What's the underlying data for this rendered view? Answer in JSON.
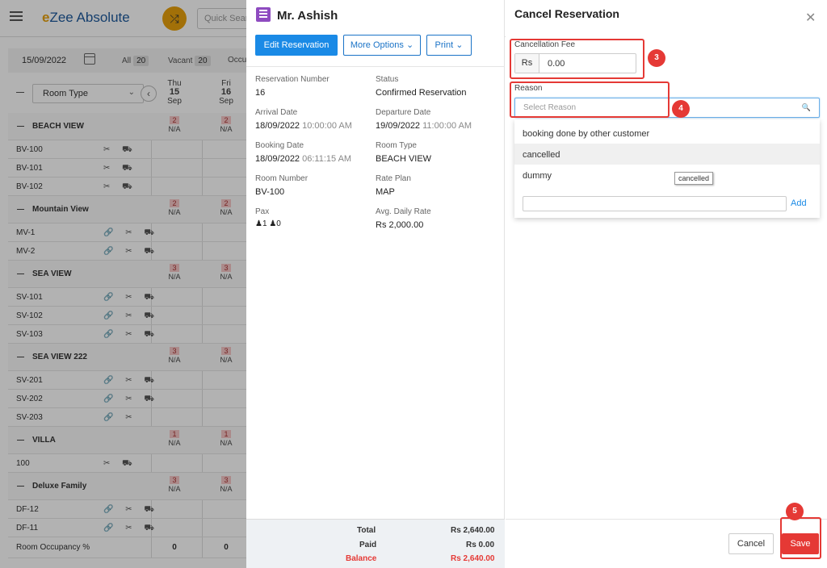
{
  "app": {
    "logo_prefix": "e",
    "logo_rest": "Zee Absolute",
    "search_placeholder": "Quick Sear"
  },
  "filters": {
    "date": "15/09/2022",
    "all_label": "All",
    "all_count": "20",
    "vacant_label": "Vacant",
    "vacant_count": "20",
    "occ_label": "Occu"
  },
  "grid": {
    "room_type_select": "Room Type",
    "days": [
      {
        "dow": "Thu",
        "day": "15",
        "mon": "Sep"
      },
      {
        "dow": "Fri",
        "day": "16",
        "mon": "Sep"
      }
    ],
    "groups": [
      {
        "name": "BEACH VIEW",
        "c1": "2",
        "c2": "2",
        "na": "N/A",
        "rooms": [
          "BV-100",
          "BV-101",
          "BV-102"
        ]
      },
      {
        "name": "Mountain View",
        "c1": "2",
        "c2": "2",
        "na": "N/A",
        "rooms": [
          "MV-1",
          "MV-2"
        ]
      },
      {
        "name": "SEA VIEW",
        "c1": "3",
        "c2": "3",
        "na": "N/A",
        "rooms": [
          "SV-101",
          "SV-102",
          "SV-103"
        ]
      },
      {
        "name": "SEA VIEW 222",
        "c1": "3",
        "c2": "3",
        "na": "N/A",
        "rooms": [
          "SV-201",
          "SV-202",
          "SV-203"
        ]
      },
      {
        "name": "VILLA",
        "c1": "1",
        "c2": "1",
        "na": "N/A",
        "rooms": [
          "100"
        ]
      },
      {
        "name": "Deluxe Family",
        "c1": "3",
        "c2": "3",
        "na": "N/A",
        "rooms": [
          "DF-12",
          "DF-11"
        ]
      }
    ],
    "occupancy_label": "Room Occupancy %",
    "occupancy_values": [
      "0",
      "0"
    ]
  },
  "reservation": {
    "guest_name": "Mr. Ashish",
    "edit_button": "Edit Reservation",
    "more_options_button": "More Options",
    "print_button": "Print",
    "fields": {
      "reservation_number_label": "Reservation Number",
      "reservation_number": "16",
      "status_label": "Status",
      "status": "Confirmed Reservation",
      "arrival_label": "Arrival Date",
      "arrival_date": "18/09/2022",
      "arrival_time": "10:00:00 AM",
      "departure_label": "Departure Date",
      "departure_date": "19/09/2022",
      "departure_time": "11:00:00 AM",
      "booking_label": "Booking Date",
      "booking_date": "18/09/2022",
      "booking_time": "06:11:15 AM",
      "room_type_label": "Room Type",
      "room_type": "BEACH VIEW",
      "room_number_label": "Room Number",
      "room_number": "BV-100",
      "rate_plan_label": "Rate Plan",
      "rate_plan": "MAP",
      "pax_label": "Pax",
      "pax_adults": "1",
      "pax_children": "0",
      "adr_label": "Avg. Daily Rate",
      "adr": "Rs 2,000.00"
    },
    "totals": {
      "total_label": "Total",
      "total": "Rs 2,640.00",
      "paid_label": "Paid",
      "paid": "Rs 0.00",
      "balance_label": "Balance",
      "balance": "Rs 2,640.00"
    }
  },
  "cancel": {
    "title": "Cancel Reservation",
    "fee_label": "Cancellation Fee",
    "fee_currency": "Rs",
    "fee_value": "0.00",
    "reason_label": "Reason",
    "reason_placeholder": "Select Reason",
    "reason_options": [
      "booking done by other customer",
      "cancelled",
      "dummy"
    ],
    "tooltip": "cancelled",
    "add_label": "Add",
    "cancel_button": "Cancel",
    "save_button": "Save",
    "callouts": [
      "3",
      "4",
      "5"
    ]
  },
  "colors": {
    "primary": "#1a8ae6",
    "danger": "#e53935",
    "brand": "#1e5a9c",
    "accent": "#e8a10c"
  }
}
